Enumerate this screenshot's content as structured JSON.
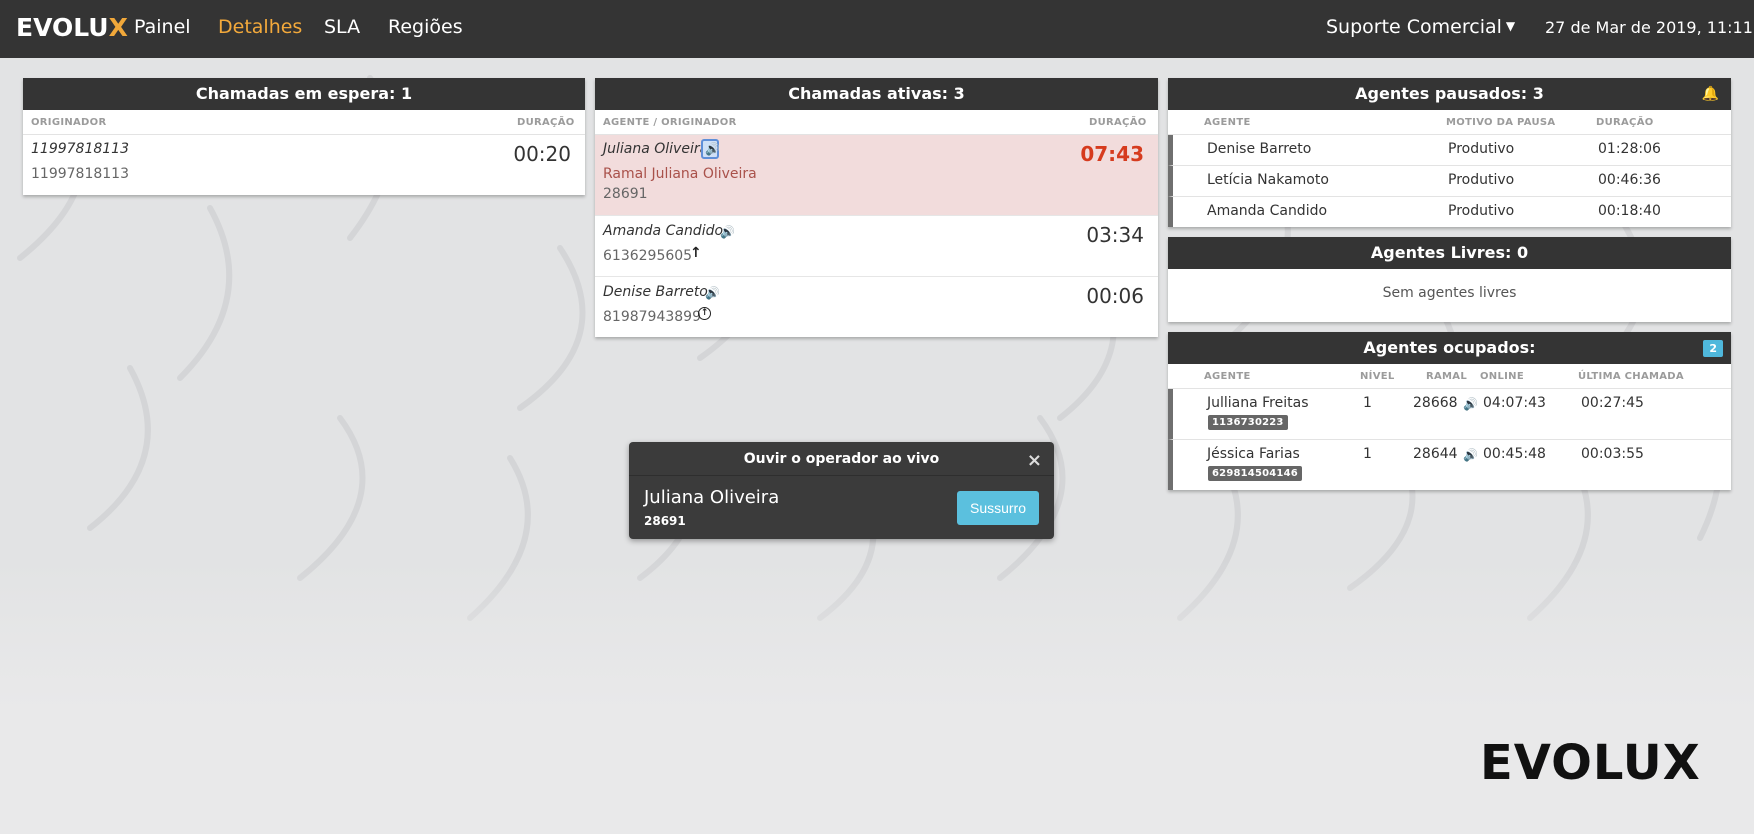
{
  "topbar": {
    "logo_main": "EVOLU",
    "logo_x": "X",
    "nav": [
      "Painel",
      "Detalhes",
      "SLA",
      "Regiões"
    ],
    "active_nav": "Detalhes",
    "queue": "Suporte Comercial",
    "datetime": "27 de Mar de 2019, 11:11"
  },
  "waiting": {
    "title": "Chamadas em espera: 1",
    "col_originator": "ORIGINADOR",
    "col_duration": "DURAÇÃO",
    "rows": [
      {
        "caller": "11997818113",
        "number": "11997818113",
        "duration": "00:20"
      }
    ]
  },
  "active": {
    "title": "Chamadas ativas: 3",
    "col_agent": "AGENTE / ORIGINADOR",
    "col_duration": "DURAÇÃO",
    "rows": [
      {
        "agent": "Juliana Oliveira",
        "line1": "Ramal Juliana Oliveira",
        "line2": "28691",
        "duration": "07:43"
      },
      {
        "agent": "Amanda Candido",
        "line1": "6136295605",
        "duration": "03:34"
      },
      {
        "agent": "Denise Barreto",
        "line1": "81987943899",
        "duration": "00:06"
      }
    ]
  },
  "paused": {
    "title": "Agentes pausados: 3",
    "col_agent": "AGENTE",
    "col_reason": "MOTIVO DA PAUSA",
    "col_duration": "DURAÇÃO",
    "rows": [
      {
        "agent": "Denise Barreto",
        "reason": "Produtivo",
        "duration": "01:28:06"
      },
      {
        "agent": "Letícia Nakamoto",
        "reason": "Produtivo",
        "duration": "00:46:36"
      },
      {
        "agent": "Amanda Candido",
        "reason": "Produtivo",
        "duration": "00:18:40"
      }
    ]
  },
  "free": {
    "title": "Agentes Livres: 0",
    "empty": "Sem agentes livres"
  },
  "busy": {
    "title": "Agentes ocupados:",
    "badge": "2",
    "col_agent": "AGENTE",
    "col_level": "NÍVEL",
    "col_ext": "RAMAL",
    "col_online": "ONLINE",
    "col_last": "ÚLTIMA CHAMADA",
    "rows": [
      {
        "agent": "Julliana Freitas",
        "tag": "1136730223",
        "level": "1",
        "ext": "28668",
        "online": "04:07:43",
        "last": "00:27:45"
      },
      {
        "agent": "Jéssica Farias",
        "tag": "629814504146",
        "level": "1",
        "ext": "28644",
        "online": "00:45:48",
        "last": "00:03:55"
      }
    ]
  },
  "popup": {
    "title": "Ouvir o operador ao vivo",
    "close": "×",
    "name": "Juliana Oliveira",
    "ext": "28691",
    "button": "Sussurro"
  },
  "footer_logo": "EVOLUX",
  "colors": {
    "accent": "#f3a93b",
    "alert": "#d63b1e",
    "highlight_row": "#f2dcdc",
    "info": "#5bc0de"
  }
}
